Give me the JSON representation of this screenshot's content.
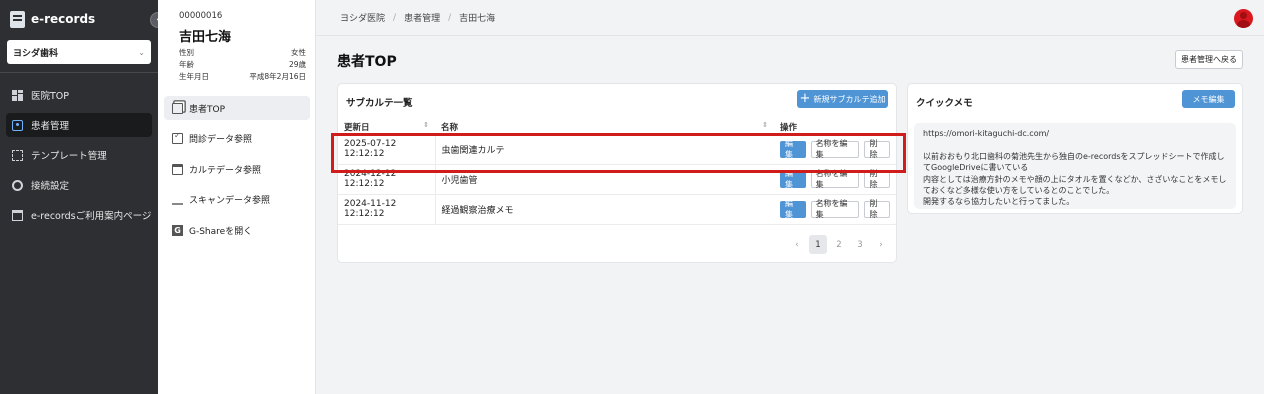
{
  "app": {
    "name": "e-records",
    "collapse_icon": "‹"
  },
  "clinic_select": {
    "value": "ヨシダ歯科"
  },
  "nav": {
    "items": [
      {
        "label": "医院TOP"
      },
      {
        "label": "患者管理"
      },
      {
        "label": "テンプレート管理"
      },
      {
        "label": "接続設定"
      },
      {
        "label": "e-recordsご利用案内ページ"
      }
    ]
  },
  "patient": {
    "id": "00000016",
    "name": "吉田七海",
    "fields": [
      {
        "label": "性別",
        "value": "女性"
      },
      {
        "label": "年齢",
        "value": "29歳"
      },
      {
        "label": "生年月日",
        "value": "平成8年2月16日"
      }
    ],
    "menu": [
      {
        "label": "患者TOP"
      },
      {
        "label": "問診データ参照"
      },
      {
        "label": "カルテデータ参照"
      },
      {
        "label": "スキャンデータ参照"
      },
      {
        "label": "G-Shareを開く"
      }
    ]
  },
  "breadcrumb": [
    "ヨシダ医院",
    "患者管理",
    "吉田七海"
  ],
  "page": {
    "title": "患者TOP",
    "back_label": "患者管理へ戻る"
  },
  "subkarte": {
    "title": "サブカルテ一覧",
    "add_label": "新規サブカルテ追加",
    "headers": {
      "date": "更新日",
      "name": "名称",
      "ops": "操作"
    },
    "rows": [
      {
        "date": "2025-07-12 12:12:12",
        "name": "虫歯関連カルテ",
        "edit": "編集",
        "rename": "名称を編集",
        "delete": "削除"
      },
      {
        "date": "2024-12-12 12:12:12",
        "name": "小児歯管",
        "edit": "編集",
        "rename": "名称を編集",
        "delete": "削除"
      },
      {
        "date": "2024-11-12 12:12:12",
        "name": "経過観察治療メモ",
        "edit": "編集",
        "rename": "名称を編集",
        "delete": "削除"
      }
    ],
    "pagination": {
      "prev": "‹",
      "pages": [
        "1",
        "2",
        "3"
      ],
      "next": "›",
      "current": "1"
    }
  },
  "memo": {
    "title": "クイックメモ",
    "edit_label": "メモ編集",
    "text": "https://omori-kitaguchi-dc.com/\n\n以前おおもり北口歯科の菊池先生から独自のe-recordsをスプレッドシートで作成してGoogleDriveに書いている\n内容としては治療方針のメモや顔の上にタオルを置くなどか、さざいなことをメモしておくなど多様な使い方をしているとのことでした。\n開発するなら協力したいと行ってました。"
  },
  "colors": {
    "accent": "#4f95d6",
    "sidebar": "#2d2f33",
    "highlight": "#d11c1c",
    "avatar": "#d9191f"
  }
}
